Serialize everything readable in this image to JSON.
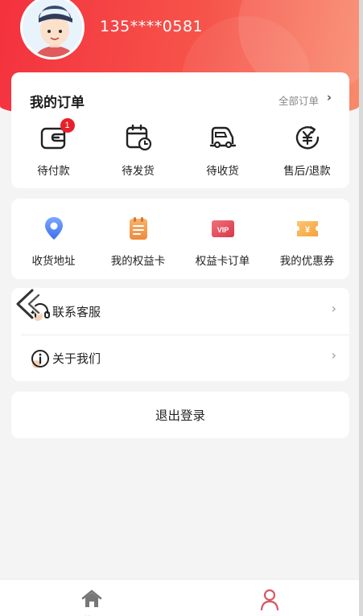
{
  "header": {
    "phone": "135****0581",
    "colors": {
      "gradient_start": "#f4313e",
      "gradient_end": "#f98a6c"
    }
  },
  "orders": {
    "title": "我的订单",
    "all_label": "全部订单",
    "items": [
      {
        "label": "待付款",
        "icon": "wallet-icon",
        "badge": "1"
      },
      {
        "label": "待发货",
        "icon": "calendar-clock-icon"
      },
      {
        "label": "待收货",
        "icon": "truck-icon"
      },
      {
        "label": "售后/退款",
        "icon": "yen-refund-icon"
      }
    ]
  },
  "services": {
    "items": [
      {
        "label": "收货地址",
        "icon": "location-pin-icon"
      },
      {
        "label": "我的权益卡",
        "icon": "notepad-icon"
      },
      {
        "label": "权益卡订单",
        "icon": "vip-card-icon",
        "icon_text": "VIP"
      },
      {
        "label": "我的优惠券",
        "icon": "coupon-icon",
        "icon_text": "¥"
      }
    ]
  },
  "menu": {
    "items": [
      {
        "label": "联系客服",
        "icon": "headset-icon"
      },
      {
        "label": "关于我们",
        "icon": "info-icon"
      }
    ]
  },
  "logout_label": "退出登录",
  "tabbar": {
    "items": [
      {
        "label": "首页",
        "icon": "home-icon"
      },
      {
        "label": "我的",
        "icon": "user-icon",
        "active": true
      }
    ]
  }
}
